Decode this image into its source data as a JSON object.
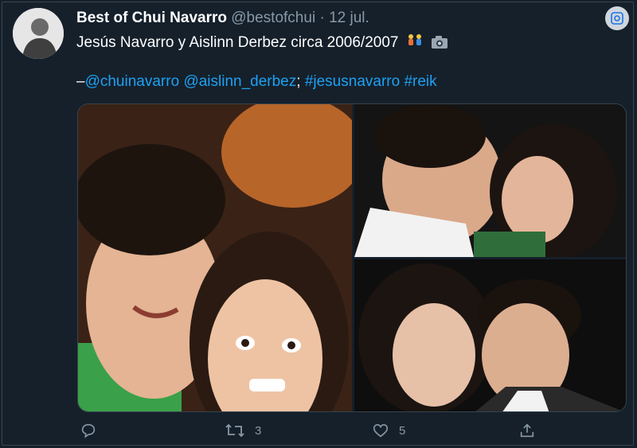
{
  "tweet": {
    "display_name": "Best of Chui Navarro",
    "handle": "@bestofchui",
    "separator": " · ",
    "date": "12 jul.",
    "text_line": "Jesús Navarro y Aislinn Derbez circa 2006/2007",
    "mention1": "@chuinavarro",
    "mention2": "@aislinn_derbez",
    "hashtag1": "#jesusnavarro",
    "hashtag2": "#reik",
    "dash": "–",
    "semicolon": ";"
  },
  "actions": {
    "reply_count": "",
    "retweet_count": "3",
    "like_count": "5"
  },
  "icons": [
    "lens-icon",
    "couple-emoji-icon",
    "camera-emoji-icon",
    "reply-icon",
    "retweet-icon",
    "like-icon",
    "share-icon"
  ],
  "colors": {
    "background": "#15202b",
    "link": "#1da1f2",
    "muted": "#8899a6"
  }
}
